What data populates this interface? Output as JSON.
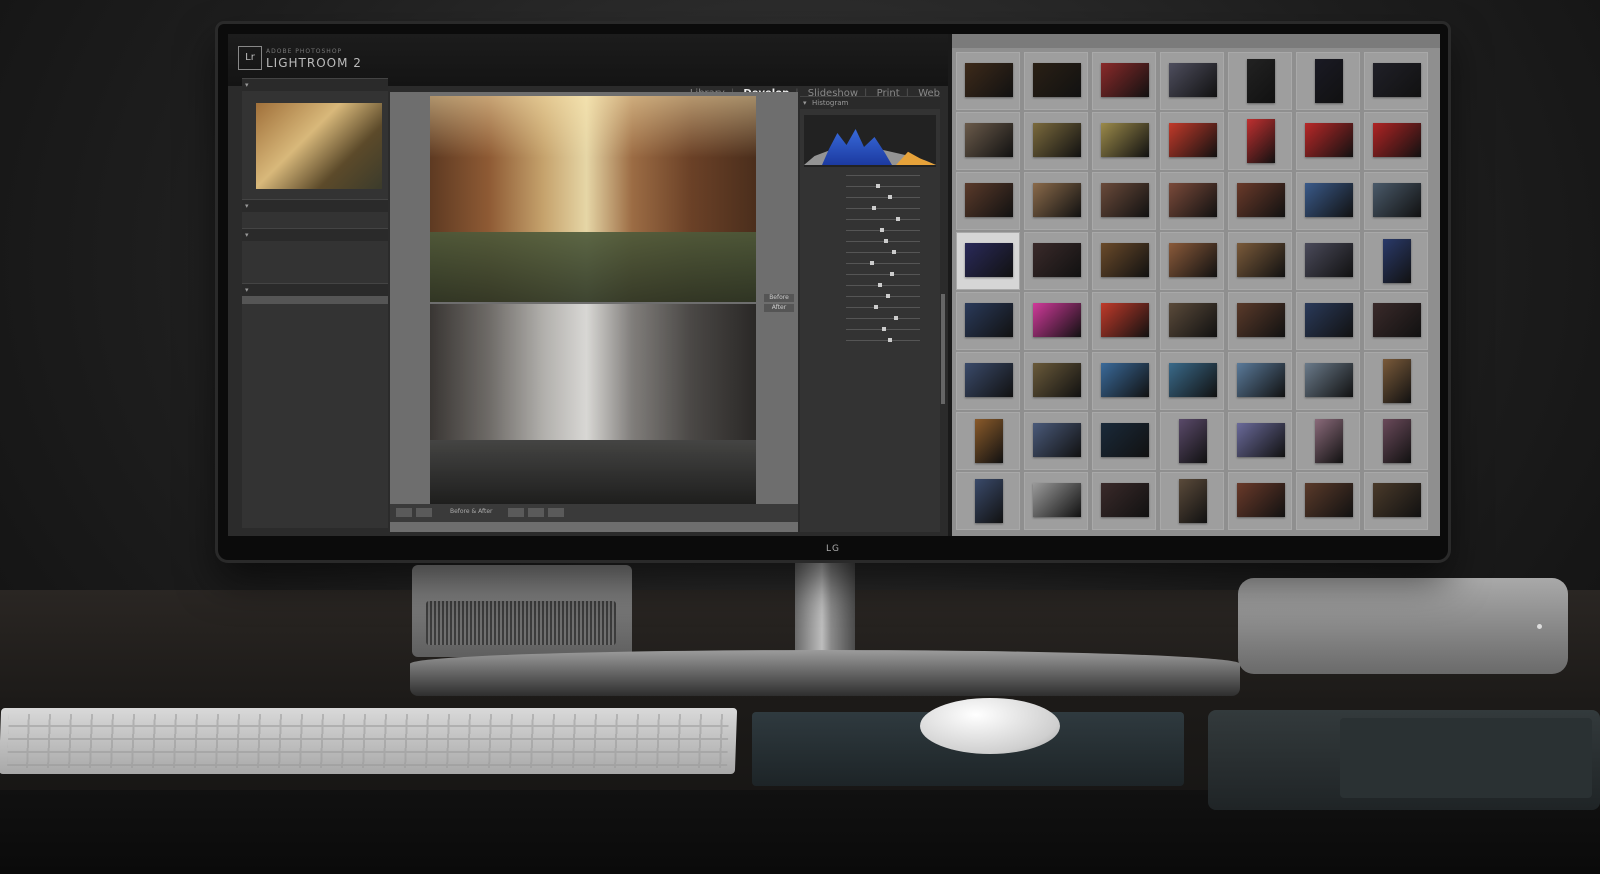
{
  "lightroom": {
    "badge": "Lr",
    "brand_small": "ADOBE PHOTOSHOP",
    "brand": "LIGHTROOM 2",
    "modules": [
      "Library",
      "Develop",
      "Slideshow",
      "Print",
      "Web"
    ],
    "active_module": "Develop",
    "histogram_label": "Histogram",
    "before_after_labels": [
      "Before",
      "After"
    ],
    "toolbar_label": "Before & After"
  },
  "monitor": {
    "logo": "LG"
  },
  "grid": {
    "colors": [
      [
        "#3d2a1a",
        "#2a2015",
        "#8a2a2a",
        "#4e4e5e",
        "#222",
        "#1a1a24",
        "#202028"
      ],
      [
        "#6a5a4a",
        "#7b6a3d",
        "#9b8a4a",
        "#c23a2a",
        "#c03030",
        "#b82828",
        "#b02424"
      ],
      [
        "#5a3a2a",
        "#8a6a4a",
        "#6a4a3a",
        "#7a4a3a",
        "#6a3a2a",
        "#3a5a8a",
        "#4a5a6a"
      ],
      [
        "#2a2a5a",
        "#3a2a2a",
        "#6a4a2a",
        "#8a5a3a",
        "#7a5a3a",
        "#4a4a5a",
        "#2a3a6a"
      ],
      [
        "#2a3a5a",
        "#d03a9a",
        "#c03a2a",
        "#5a4a3a",
        "#5a3a2a",
        "#2a3a5a",
        "#3a2a2a"
      ],
      [
        "#3a4a6a",
        "#6a5a3a",
        "#3a6a9a",
        "#3a6a8a",
        "#5a7a9a",
        "#6a7a8a",
        "#7a5a3a"
      ],
      [
        "#8a5a2a",
        "#4a5a7a",
        "#1a2a3a",
        "#5a4a6a",
        "#6a6a9a",
        "#8a6a7a",
        "#6a4a5a"
      ],
      [
        "#3a4a6a",
        "#9a9a9a",
        "#3a2a2a",
        "#5a4a3a",
        "#6a3a2a",
        "#5a3a2a",
        "#4a3a2a"
      ]
    ],
    "tall": [
      [
        0,
        4
      ],
      [
        0,
        5
      ],
      [
        1,
        4
      ],
      [
        3,
        6
      ],
      [
        5,
        6
      ],
      [
        6,
        0
      ],
      [
        6,
        3
      ],
      [
        6,
        5
      ],
      [
        6,
        6
      ],
      [
        7,
        0
      ],
      [
        7,
        3
      ]
    ],
    "selected": [
      3,
      0
    ]
  }
}
